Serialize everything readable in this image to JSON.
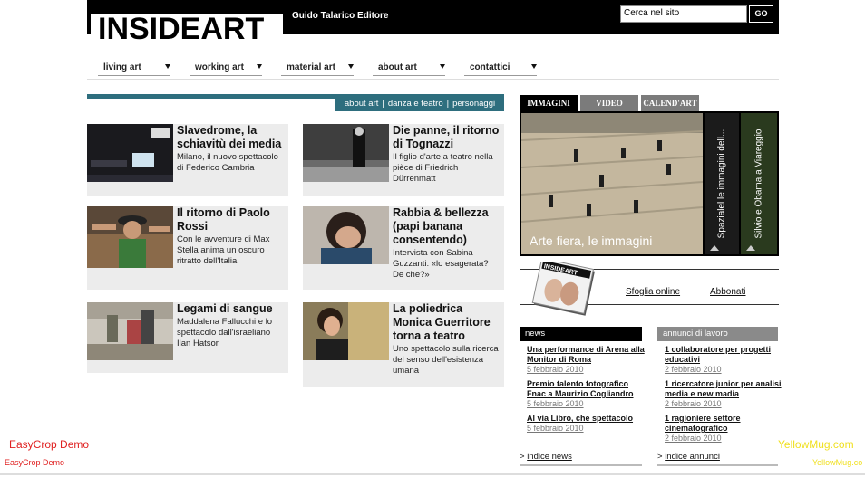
{
  "header": {
    "logo": "INSIDEART",
    "publisher": "Guido Talarico Editore",
    "search_value": "Cerca nel sito",
    "search_button": "GO"
  },
  "nav": [
    "living art",
    "working art",
    "material art",
    "about art",
    "contattici"
  ],
  "section_tabs": [
    "about art",
    "danza e teatro",
    "personaggi"
  ],
  "articles": [
    {
      "title": "Slavedrome, la schiavitù dei media",
      "desc": "Milano, il nuovo spettacolo di Federico Cambria"
    },
    {
      "title": "Die panne, il ritorno di Tognazzi",
      "desc": "Il figlio d'arte a teatro nella pièce di Friedrich Dürrenmatt"
    },
    {
      "title": "Il ritorno di Paolo Rossi",
      "desc": "Con le avventure di Max Stella anima un oscuro ritratto dell'Italia"
    },
    {
      "title": "Rabbia & bellezza (papi banana consentendo)",
      "desc": "Intervista con Sabina Guzzanti: «lo esagerata? De che?»"
    },
    {
      "title": "Legami di sangue",
      "desc": "Maddalena Fallucchi e lo spettacolo dall'israeliano Ilan Hatsor"
    },
    {
      "title": "La poliedrica Monica Guerritore torna a teatro",
      "desc": "Uno spettacolo sulla ricerca del senso dell'esistenza umana"
    }
  ],
  "media": {
    "tabs": [
      "IMMAGINI",
      "VIDEO",
      "CALEND'ART"
    ],
    "caption": "Arte fiera, le immagini",
    "side_items": [
      "Spazialel le immagini dell...",
      "Silvio e Obama a Viareggio"
    ]
  },
  "magazine": {
    "cover_label": "INSIDEART",
    "links": [
      "Sfoglia online",
      "Abbonati"
    ]
  },
  "news": {
    "title": "news",
    "items": [
      {
        "title": "Una performance di Arena alla Monitor di Roma",
        "date": "5 febbraio 2010"
      },
      {
        "title": "Premio talento fotografico Fnac a Maurizio Cogliandro",
        "date": "5 febbraio 2010"
      },
      {
        "title": "Al via Libro, che spettacolo",
        "date": "5 febbraio 2010"
      }
    ],
    "footer": "indice news"
  },
  "jobs": {
    "title": "annunci di lavoro",
    "items": [
      {
        "title": "1 collaboratore per progetti educativi",
        "date": "2 febbraio 2010"
      },
      {
        "title": "1 ricercatore junior per analisi media e new madia",
        "date": "2 febbraio 2010"
      },
      {
        "title": "1 ragioniere settore cinematografico",
        "date": "2 febbraio 2010"
      }
    ],
    "footer": "indice annunci"
  },
  "watermarks": {
    "left_big": "EasyCrop Demo",
    "left_small": "EasyCrop Demo",
    "right_big": "YellowMug.com",
    "right_small": "YellowMug.co"
  }
}
